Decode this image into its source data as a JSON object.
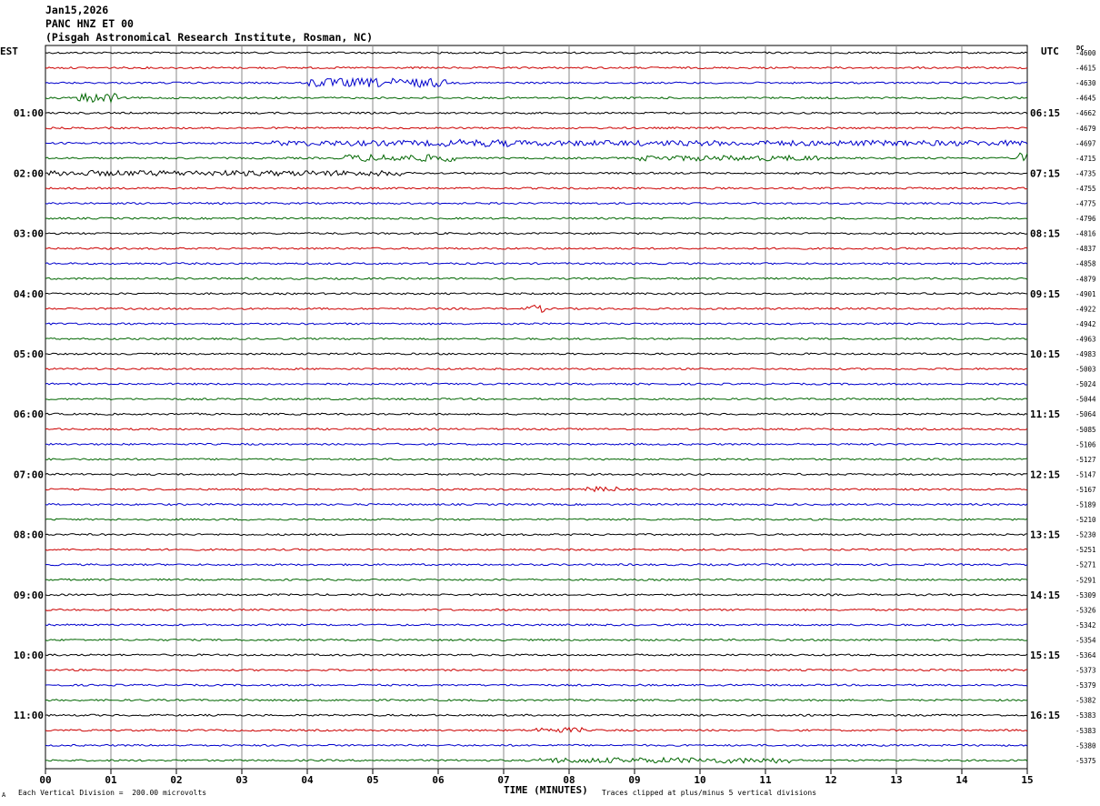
{
  "header": {
    "date": "Jan15,2026",
    "station": "PANC HNZ ET 00",
    "institute": "(Pisgah Astronomical Research Institute, Rosman, NC)"
  },
  "axes": {
    "left_zone": "EST",
    "right_zone": "UTC",
    "dc_label": "DC",
    "xlabel": "TIME (MINUTES)",
    "scale_note": "Each Vertical Division =  200.00 microvolts",
    "clip_note": "Traces clipped at plus/minus 5 vertical divisions",
    "corner_mark": "A"
  },
  "colors": [
    "#000000",
    "#cc0000",
    "#0000cc",
    "#006600"
  ],
  "chart_data": {
    "type": "line",
    "title": "PANC HNZ ET 00",
    "xlabel": "TIME (MINUTES)",
    "xlim": [
      0,
      15
    ],
    "x_ticks": [
      "00",
      "01",
      "02",
      "03",
      "04",
      "05",
      "06",
      "07",
      "08",
      "09",
      "10",
      "11",
      "12",
      "13",
      "14",
      "15"
    ],
    "rows": 48,
    "left_hour_labels": [
      "01:00",
      "02:00",
      "03:00",
      "04:00",
      "05:00",
      "06:00",
      "07:00",
      "08:00",
      "09:00",
      "10:00",
      "11:00"
    ],
    "right_hour_labels": [
      "06:15",
      "07:15",
      "08:15",
      "09:15",
      "10:15",
      "11:15",
      "12:15",
      "13:15",
      "14:15",
      "15:15",
      "16:15"
    ],
    "dc_offsets": [
      "-4600",
      "-4615",
      "-4630",
      "-4645",
      "-4662",
      "-4679",
      "-4697",
      "-4715",
      "-4735",
      "-4755",
      "-4775",
      "-4796",
      "-4816",
      "-4837",
      "-4858",
      "-4879",
      "-4901",
      "-4922",
      "-4942",
      "-4963",
      "-4983",
      "-5003",
      "-5024",
      "-5044",
      "-5064",
      "-5085",
      "-5106",
      "-5127",
      "-5147",
      "-5167",
      "-5189",
      "-5210",
      "-5230",
      "-5251",
      "-5271",
      "-5291",
      "-5309",
      "-5326",
      "-5342",
      "-5354",
      "-5364",
      "-5373",
      "-5379",
      "-5382",
      "-5383",
      "-5383",
      "-5380",
      "-5375"
    ]
  }
}
